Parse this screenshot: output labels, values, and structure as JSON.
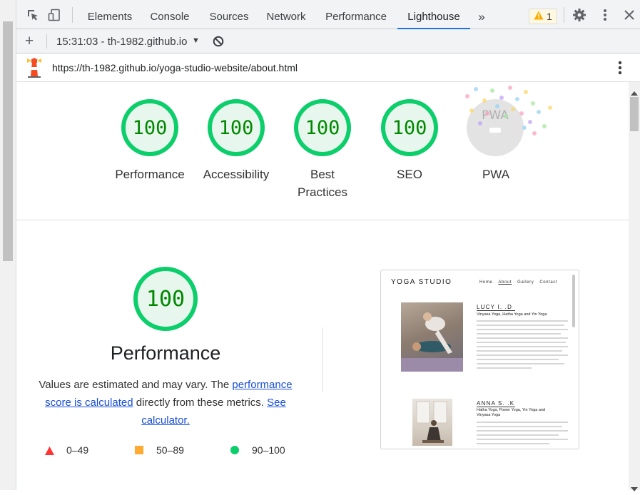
{
  "toolbar": {
    "tabs": [
      "Elements",
      "Console",
      "Sources",
      "Network",
      "Performance",
      "Lighthouse"
    ],
    "active_tab": "Lighthouse",
    "more_tabs": "»",
    "warnings_count": "1"
  },
  "bar2": {
    "add": "+",
    "report_label": "15:31:03 - th-1982.github.io",
    "dropdown": "▼"
  },
  "urlbar": {
    "url": "https://th-1982.github.io/yoga-studio-website/about.html"
  },
  "scores": [
    {
      "value": "100",
      "label": "Performance"
    },
    {
      "value": "100",
      "label": "Accessibility"
    },
    {
      "value": "100",
      "label": "Best Practices"
    },
    {
      "value": "100",
      "label": "SEO"
    },
    {
      "value": "",
      "label": "PWA"
    }
  ],
  "performance": {
    "score": "100",
    "title": "Performance",
    "desc_1": "Values are estimated and may vary. The ",
    "link_1": "performance score is calculated",
    "desc_2": " directly from these metrics. ",
    "link_2": "See calculator.",
    "legend": [
      {
        "range": "0–49",
        "color": "#ff3333"
      },
      {
        "range": "50–89",
        "color": "#ffaa33"
      },
      {
        "range": "90–100",
        "color": "#0cce6b"
      }
    ]
  },
  "thumbnail": {
    "brand": "YOGA STUDIO",
    "nav": [
      "Home",
      "About",
      "Gallery",
      "Contact"
    ],
    "person1_name": "LUCY I. .D",
    "person1_styles": "Vinyasa Yoga, Hatha Yoga and Yin Yoga",
    "person2_name": "ANNA S. .K",
    "person2_styles": "Hatha Yoga, Power Yoga, Yin Yoga and Vinyasa Yoga"
  },
  "colors": {
    "pass": "#0cce6b",
    "pass_bg": "#e8f7ee",
    "pass_text": "#008800",
    "accent": "#1a73e8"
  }
}
